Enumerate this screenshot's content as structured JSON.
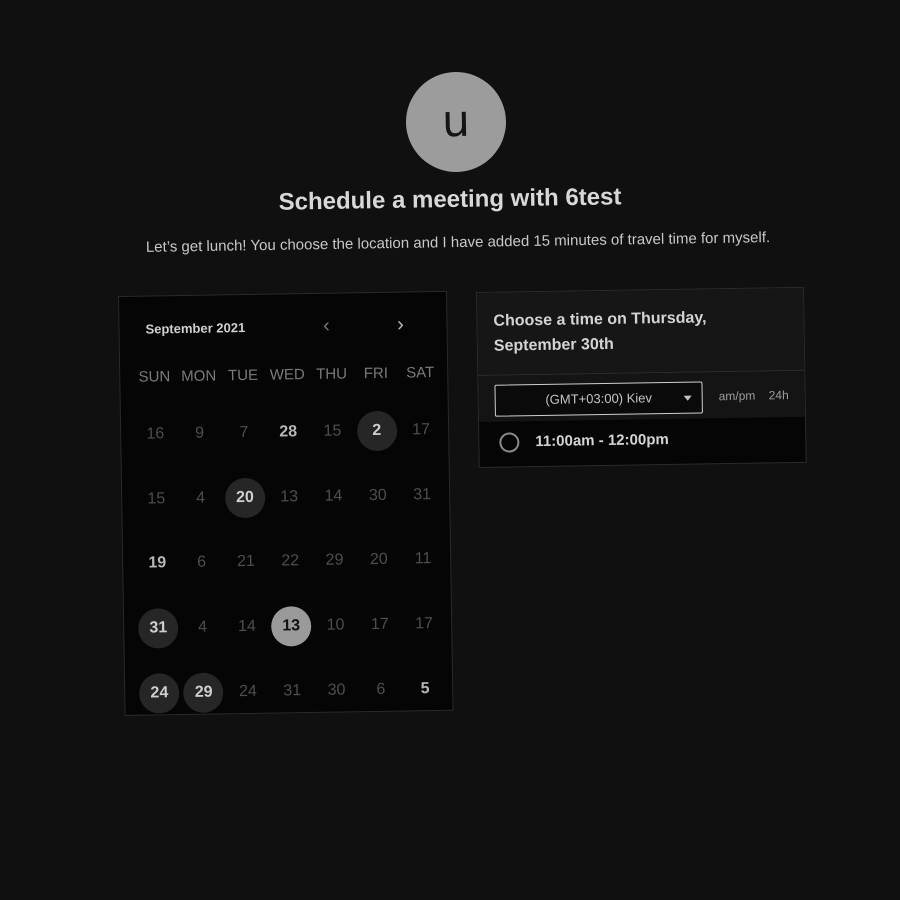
{
  "header": {
    "avatar_letter": "u",
    "title": "Schedule a meeting with 6test",
    "description": "Let’s get lunch! You choose the location and I have added 15 minutes of travel time for myself."
  },
  "calendar": {
    "month_label": "September 2021",
    "prev_icon": "chevron-left-icon",
    "next_icon": "chevron-right-icon",
    "weekdays": [
      "SUN",
      "MON",
      "TUE",
      "WED",
      "THU",
      "FRI",
      "SAT"
    ],
    "days": [
      {
        "label": "16",
        "state": "unavailable"
      },
      {
        "label": "9",
        "state": "unavailable"
      },
      {
        "label": "7",
        "state": "unavailable"
      },
      {
        "label": "28",
        "state": "bold"
      },
      {
        "label": "15",
        "state": "unavailable"
      },
      {
        "label": "2",
        "state": "available"
      },
      {
        "label": "17",
        "state": "unavailable"
      },
      {
        "label": "15",
        "state": "unavailable"
      },
      {
        "label": "4",
        "state": "unavailable"
      },
      {
        "label": "20",
        "state": "available"
      },
      {
        "label": "13",
        "state": "unavailable"
      },
      {
        "label": "14",
        "state": "unavailable"
      },
      {
        "label": "30",
        "state": "unavailable"
      },
      {
        "label": "31",
        "state": "unavailable"
      },
      {
        "label": "19",
        "state": "bold"
      },
      {
        "label": "6",
        "state": "unavailable"
      },
      {
        "label": "21",
        "state": "unavailable"
      },
      {
        "label": "22",
        "state": "unavailable"
      },
      {
        "label": "29",
        "state": "unavailable"
      },
      {
        "label": "20",
        "state": "unavailable"
      },
      {
        "label": "11",
        "state": "unavailable"
      },
      {
        "label": "31",
        "state": "available"
      },
      {
        "label": "4",
        "state": "unavailable"
      },
      {
        "label": "14",
        "state": "unavailable"
      },
      {
        "label": "13",
        "state": "selected"
      },
      {
        "label": "10",
        "state": "unavailable"
      },
      {
        "label": "17",
        "state": "unavailable"
      },
      {
        "label": "17",
        "state": "unavailable"
      },
      {
        "label": "24",
        "state": "available"
      },
      {
        "label": "29",
        "state": "available"
      },
      {
        "label": "24",
        "state": "unavailable"
      },
      {
        "label": "31",
        "state": "unavailable"
      },
      {
        "label": "30",
        "state": "unavailable"
      },
      {
        "label": "6",
        "state": "unavailable"
      },
      {
        "label": "5",
        "state": "bold"
      }
    ]
  },
  "time_panel": {
    "title": "Choose a time on Thursday, September 30th",
    "timezone": "(GMT+03:00) Kiev",
    "format_12h": "am/pm",
    "format_24h": "24h",
    "slots": [
      {
        "label": "11:00am - 12:00pm"
      }
    ]
  },
  "colors": {
    "background": "#101010",
    "panel": "#050505",
    "available_day": "#262626",
    "selected_day": "#9a9a9a"
  }
}
